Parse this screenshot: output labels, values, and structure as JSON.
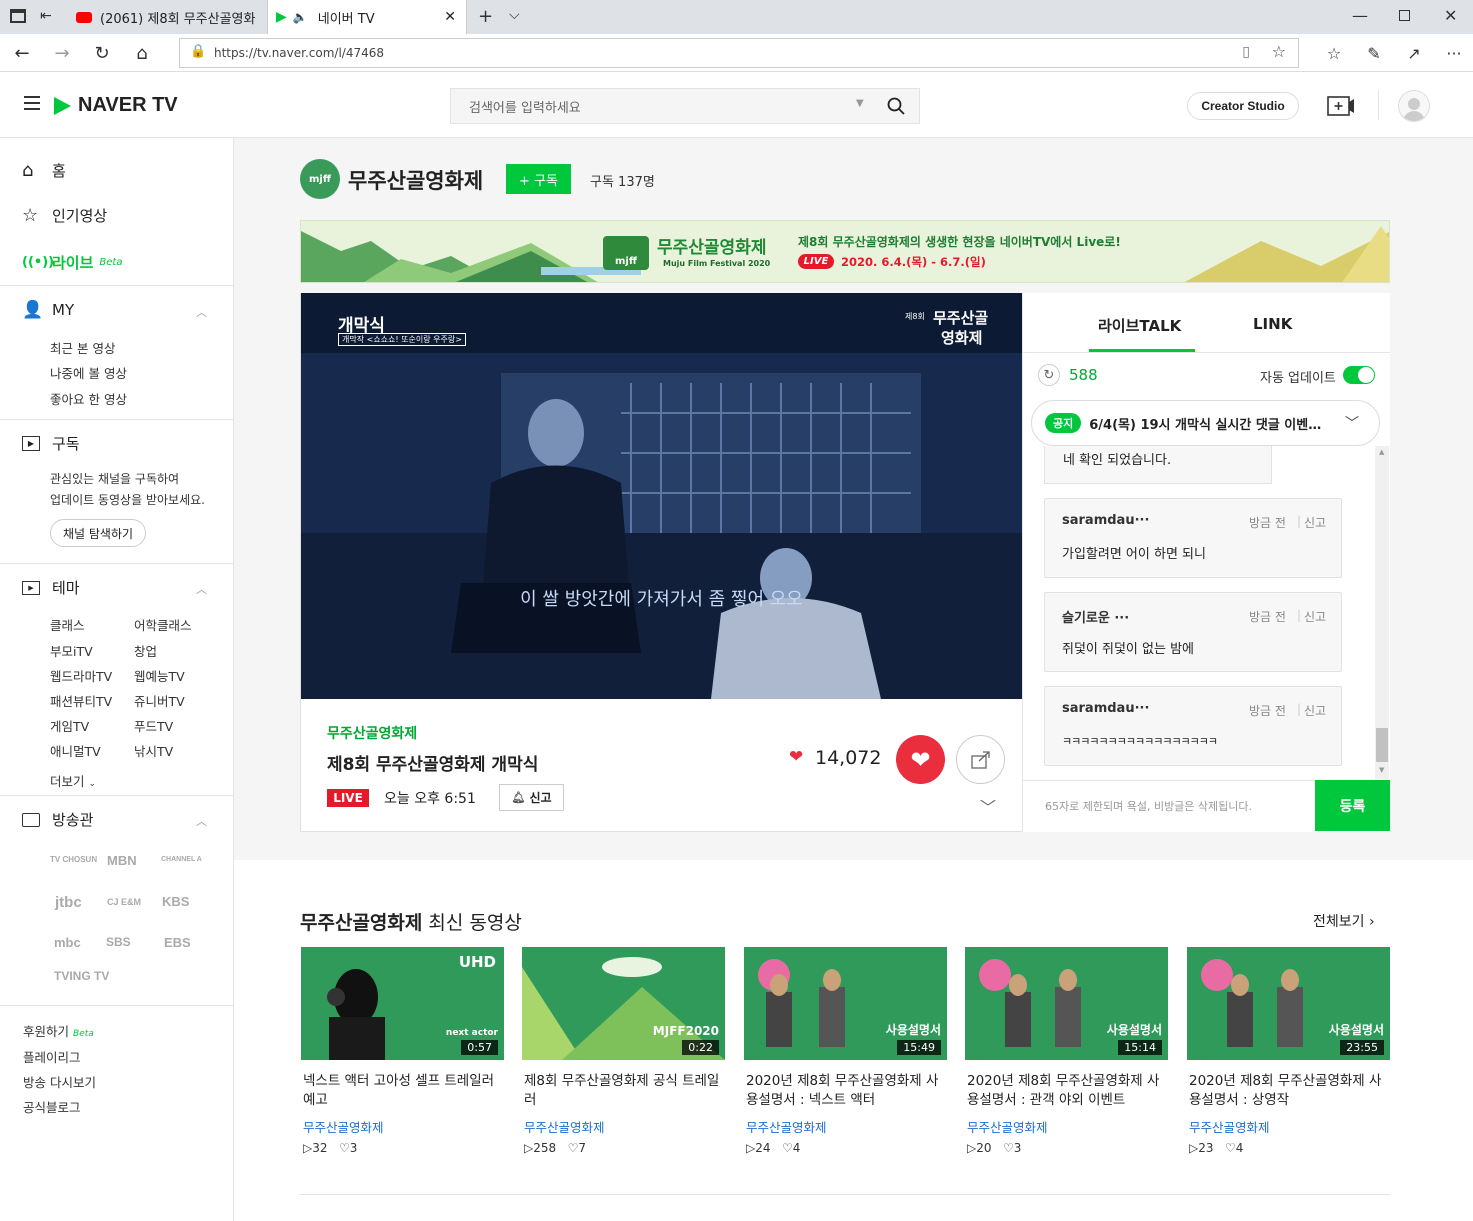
{
  "browser": {
    "tabs": [
      {
        "label": "(2061) 제8회 무주산골영화"
      },
      {
        "label": "네이버 TV"
      }
    ],
    "url": "https://tv.naver.com/l/47468"
  },
  "header": {
    "logo": "NAVER TV",
    "search_placeholder": "검색어를 입력하세요",
    "creator_studio": "Creator Studio"
  },
  "sidebar": {
    "home": "홈",
    "popular": "인기영상",
    "live": "라이브",
    "live_badge": "Beta",
    "my": "MY",
    "my_items": [
      "최근 본 영상",
      "나중에 볼 영상",
      "좋아요 한 영상"
    ],
    "subscribe": "구독",
    "subscribe_desc1": "관심있는 채널을 구독하여",
    "subscribe_desc2": "업데이트 동영상을 받아보세요.",
    "explore_btn": "채널 탐색하기",
    "theme": "테마",
    "theme_items": [
      "클래스",
      "어학클래스",
      "부모iTV",
      "창업",
      "웹드라마TV",
      "웹예능TV",
      "패션뷰티TV",
      "쥬니버TV",
      "게임TV",
      "푸드TV",
      "애니멀TV",
      "낚시TV"
    ],
    "more": "더보기",
    "broadcast": "방송관",
    "brands": [
      "TV CHOSUN",
      "MBN",
      "CHANNEL A",
      "jtbc",
      "CJ E&M",
      "KBS",
      "mbc",
      "SBS",
      "EBS",
      "TVING TV"
    ],
    "footer_items": [
      "후원하기",
      "플레이리그",
      "방송 다시보기",
      "공식블로그"
    ],
    "footer_badge": "Beta"
  },
  "channel": {
    "name": "무주산골영화제",
    "logo_text": "mjff",
    "subscribe_btn": "+ 구독",
    "subscriber_label": "구독 137명"
  },
  "banner": {
    "festival_name": "무주산골영화제",
    "festival_en": "Muju Film Festival 2020",
    "headline": "제8회 무주산골영화제의 생생한 현장을 네이버TV에서 Live로!",
    "live": "LIVE",
    "dates": "2020. 6.4.(목) - 6.7.(일)"
  },
  "video": {
    "overlay_title": "개막식",
    "overlay_sub": "개막작 <쇼쇼쇼! 또순이랑 우주랑>",
    "overlay_logo1": "제8회",
    "overlay_logo2": "무주산골",
    "overlay_logo3": "영화제",
    "subtitle": "이 쌀 방앗간에 가져가서 좀 찧어 오오",
    "channel": "무주산골영화제",
    "title": "제8회 무주산골영화제 개막식",
    "live_badge": "LIVE",
    "time": "오늘 오후 6:51",
    "report": "신고",
    "likes": "14,072"
  },
  "chat": {
    "tab_talk": "라이브TALK",
    "tab_link": "LINK",
    "count": "588",
    "auto_update": "자동 업데이트",
    "notice_badge": "공지",
    "notice": "6/4(목) 19시 개막식 실시간 댓글 이벤…",
    "partial_msg": "네 확인 되었습니다.",
    "messages": [
      {
        "user": "saramdau···",
        "time": "방금 전",
        "report": "신고",
        "text": "가입할려면 어이 하면 되니"
      },
      {
        "user": "슬기로운 ···",
        "time": "방금 전",
        "report": "신고",
        "text": "쥐덫이 쥐덫이 없는 밤에"
      },
      {
        "user": "saramdau···",
        "time": "방금 전",
        "report": "신고",
        "text": "ㅋㅋㅋㅋㅋㅋㅋㅋㅋㅋㅋㅋㅋㅋㅋㅋㅋ"
      }
    ],
    "input_placeholder": "65자로 제한되며 욕설, 비방글은 삭제됩니다.",
    "submit": "등록"
  },
  "latest": {
    "heading_channel": "무주산골영화제",
    "heading_rest": "최신 동영상",
    "view_all": "전체보기",
    "videos": [
      {
        "title": "넥스트 액터 고아성 셀프 트레일러 예고",
        "channel": "무주산골영화제",
        "plays": "32",
        "likes": "3",
        "duration": "0:57",
        "thumb_text": "next actor",
        "badge": "UHD"
      },
      {
        "title": "제8회 무주산골영화제 공식 트레일러",
        "channel": "무주산골영화제",
        "plays": "258",
        "likes": "7",
        "duration": "0:22",
        "thumb_text": "MJFF2020",
        "badge": ""
      },
      {
        "title": "2020년 제8회 무주산골영화제 사용설명서 : 넥스트 액터",
        "channel": "무주산골영화제",
        "plays": "24",
        "likes": "4",
        "duration": "15:49",
        "thumb_text": "사용설명서",
        "badge": ""
      },
      {
        "title": "2020년 제8회 무주산골영화제 사용설명서 : 관객 야외 이벤트",
        "channel": "무주산골영화제",
        "plays": "20",
        "likes": "3",
        "duration": "15:14",
        "thumb_text": "사용설명서",
        "badge": ""
      },
      {
        "title": "2020년 제8회 무주산골영화제 사용설명서 : 상영작",
        "channel": "무주산골영화제",
        "plays": "23",
        "likes": "4",
        "duration": "23:55",
        "thumb_text": "사용설명서",
        "badge": ""
      }
    ]
  },
  "colors": {
    "accent": "#00c73c",
    "live": "#e5192a",
    "heart": "#ea2e3d"
  }
}
